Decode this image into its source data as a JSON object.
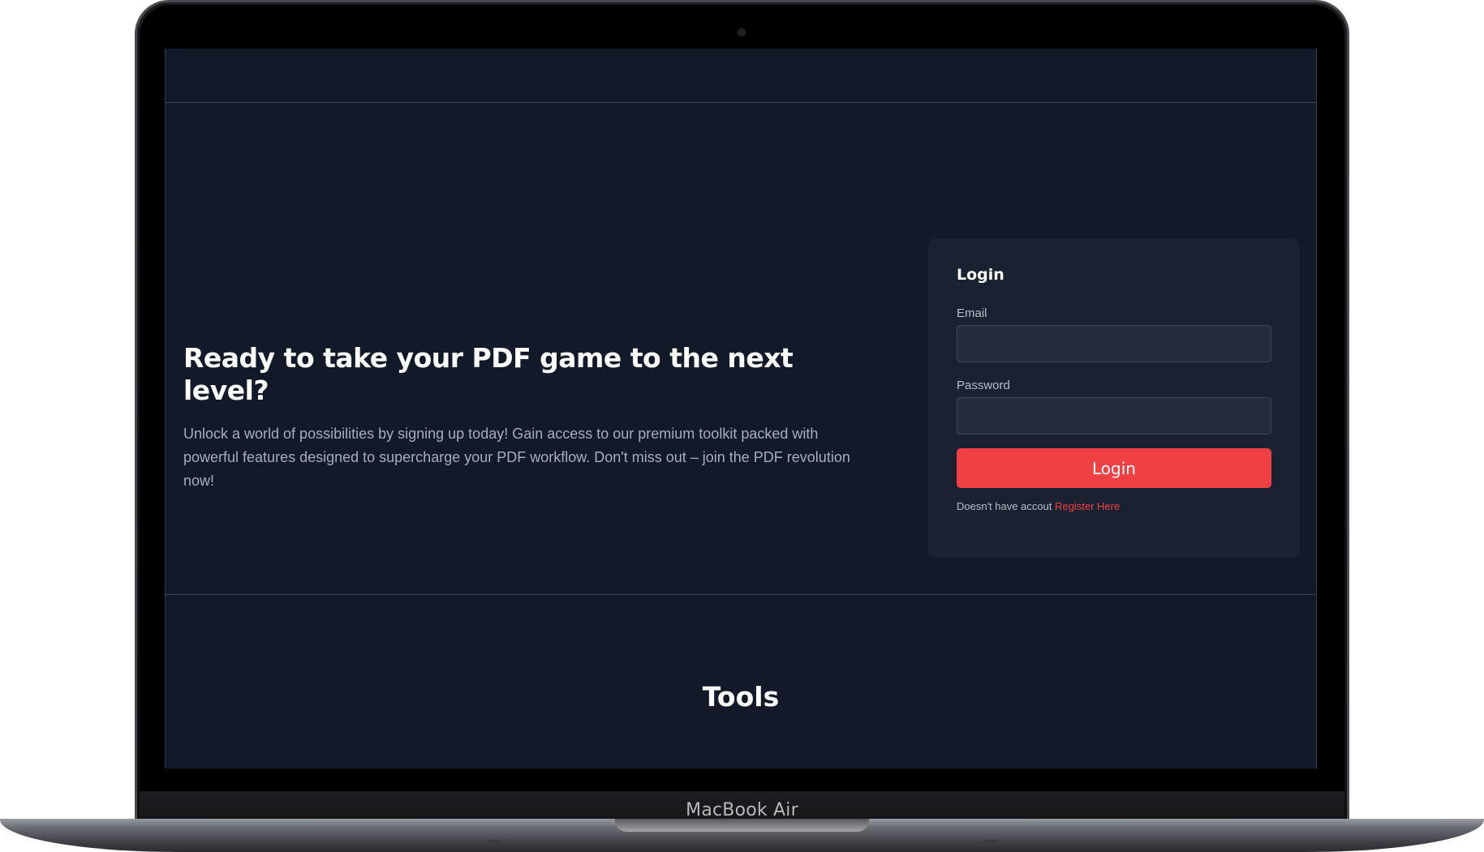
{
  "device": {
    "label": "MacBook Air"
  },
  "hero": {
    "title": "Ready to take your PDF game to the next level?",
    "description": "Unlock a world of possibilities by signing up today! Gain access to our premium toolkit packed with powerful features designed to supercharge your PDF workflow. Don't miss out – join the PDF revolution now!"
  },
  "login": {
    "title": "Login",
    "email_label": "Email",
    "email_value": "",
    "password_label": "Password",
    "password_value": "",
    "submit_label": "Login",
    "register_prompt": "Doesn't have accout",
    "register_link": "Register Here"
  },
  "tools": {
    "title": "Tools"
  },
  "colors": {
    "page_bg": "#121a2a",
    "card_bg": "#1a2232",
    "input_bg": "#242c3b",
    "accent": "#ef4044"
  }
}
